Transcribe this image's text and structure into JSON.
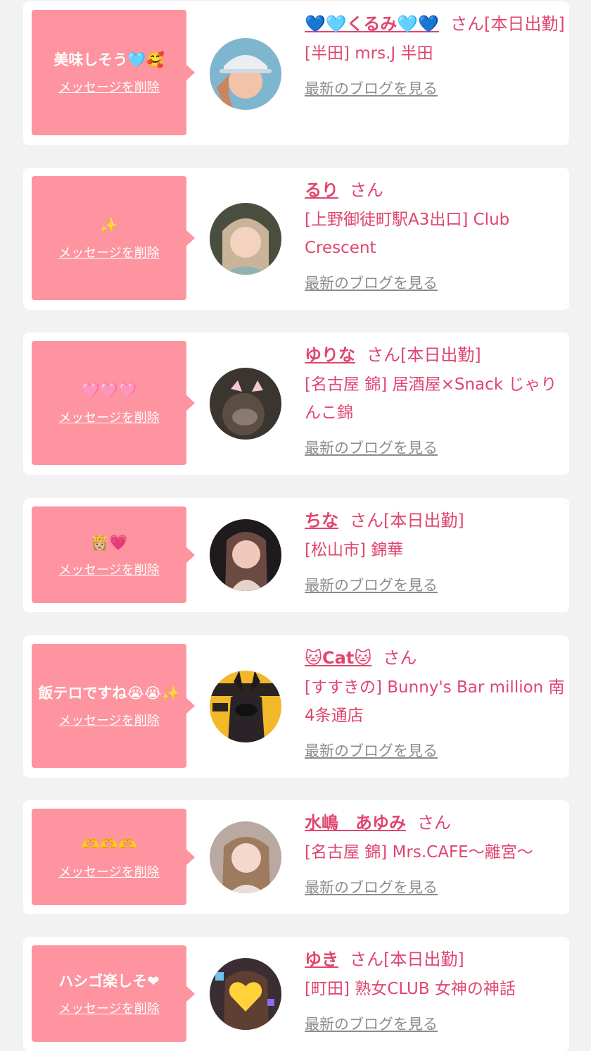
{
  "cards": [
    {
      "message": "美味しそう🩵🥰",
      "delete_label": "メッセージを削除",
      "name": "💙🩵くるみ🩵💙",
      "suffix": "さん[本日出勤]",
      "shop": "[半田] mrs.J 半田",
      "blog_label": "最新のブログを見る"
    },
    {
      "message": "✨",
      "delete_label": "メッセージを削除",
      "name": "るり",
      "suffix": "さん",
      "shop": "[上野御徒町駅A3出口] Club Crescent",
      "blog_label": "最新のブログを見る"
    },
    {
      "message": "🩷🩷🩷",
      "delete_label": "メッセージを削除",
      "name": "ゆりな",
      "suffix": "さん[本日出勤]",
      "shop": "[名古屋 錦] 居酒屋×Snack じゃりんこ錦",
      "blog_label": "最新のブログを見る"
    },
    {
      "message": "👸🏼💗",
      "delete_label": "メッセージを削除",
      "name": "ちな",
      "suffix": "さん[本日出勤]",
      "shop": "[松山市] 錦華",
      "blog_label": "最新のブログを見る"
    },
    {
      "message": "飯テロですね😭😭✨",
      "delete_label": "メッセージを削除",
      "name": "🐱Cat🐱",
      "suffix": "さん",
      "shop": "[すすきの] Bunny's Bar million 南4条通店",
      "blog_label": "最新のブログを見る"
    },
    {
      "message": "🫶🫶🫶",
      "delete_label": "メッセージを削除",
      "name": "水嶋　あゆみ",
      "suffix": "さん",
      "shop": "[名古屋 錦] Mrs.CAFE～離宮～",
      "blog_label": "最新のブログを見る"
    },
    {
      "message": "ハシゴ楽しそ❤",
      "delete_label": "メッセージを削除",
      "name": "ゆき",
      "suffix": "さん[本日出勤]",
      "shop": "[町田] 熟女CLUB 女神の神話",
      "blog_label": "最新のブログを見る"
    }
  ],
  "colors": {
    "bubble": "#fd949f",
    "accent": "#e0456f",
    "link_gray": "#8c8c8c",
    "background": "#f2f2f2"
  }
}
